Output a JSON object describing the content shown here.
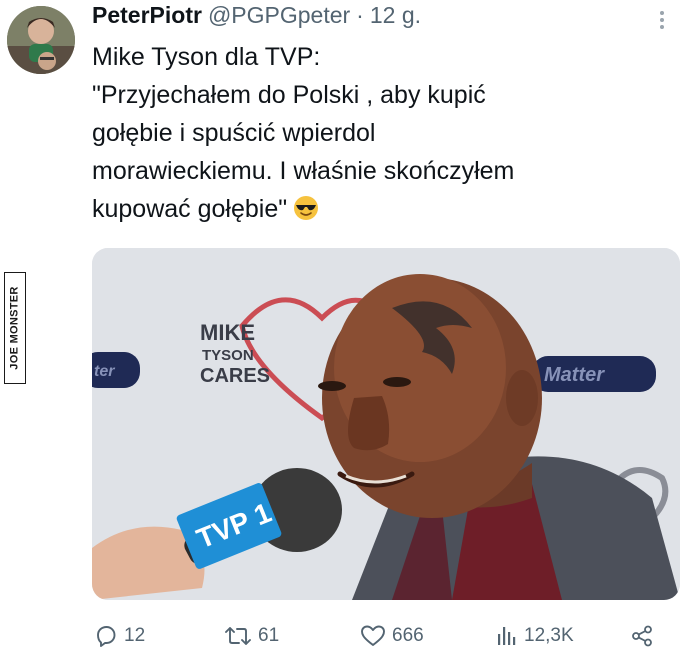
{
  "tweet": {
    "author_name": "PeterPiotr",
    "author_handle": "@PGPGpeter",
    "separator": "·",
    "timestamp": "12 g.",
    "text_lines": [
      "Mike Tyson dla TVP:",
      "\"Przyjechałem do Polski , aby kupić",
      "gołębie i spuścić wpierdol",
      "morawieckiemu. I właśnie skończyłem",
      "kupować gołębie\""
    ],
    "emoji": "smiling-face-with-sunglasses-icon"
  },
  "media": {
    "backdrop_text": [
      "MIKE",
      "TYSON",
      "CARES"
    ],
    "banner_right": "Matter",
    "banner_left": "ter",
    "mic_flag": "TVP 1",
    "colors": {
      "tvp_blue": "#1f8fd6",
      "backdrop_red": "#c8323a",
      "banner_navy": "#1f2a55"
    }
  },
  "actions": {
    "replies": "12",
    "reposts": "61",
    "likes": "666",
    "views": "12,3K"
  },
  "watermark": "JOE MONSTER",
  "colors": {
    "text": "#0f1419",
    "muted": "#536471"
  }
}
